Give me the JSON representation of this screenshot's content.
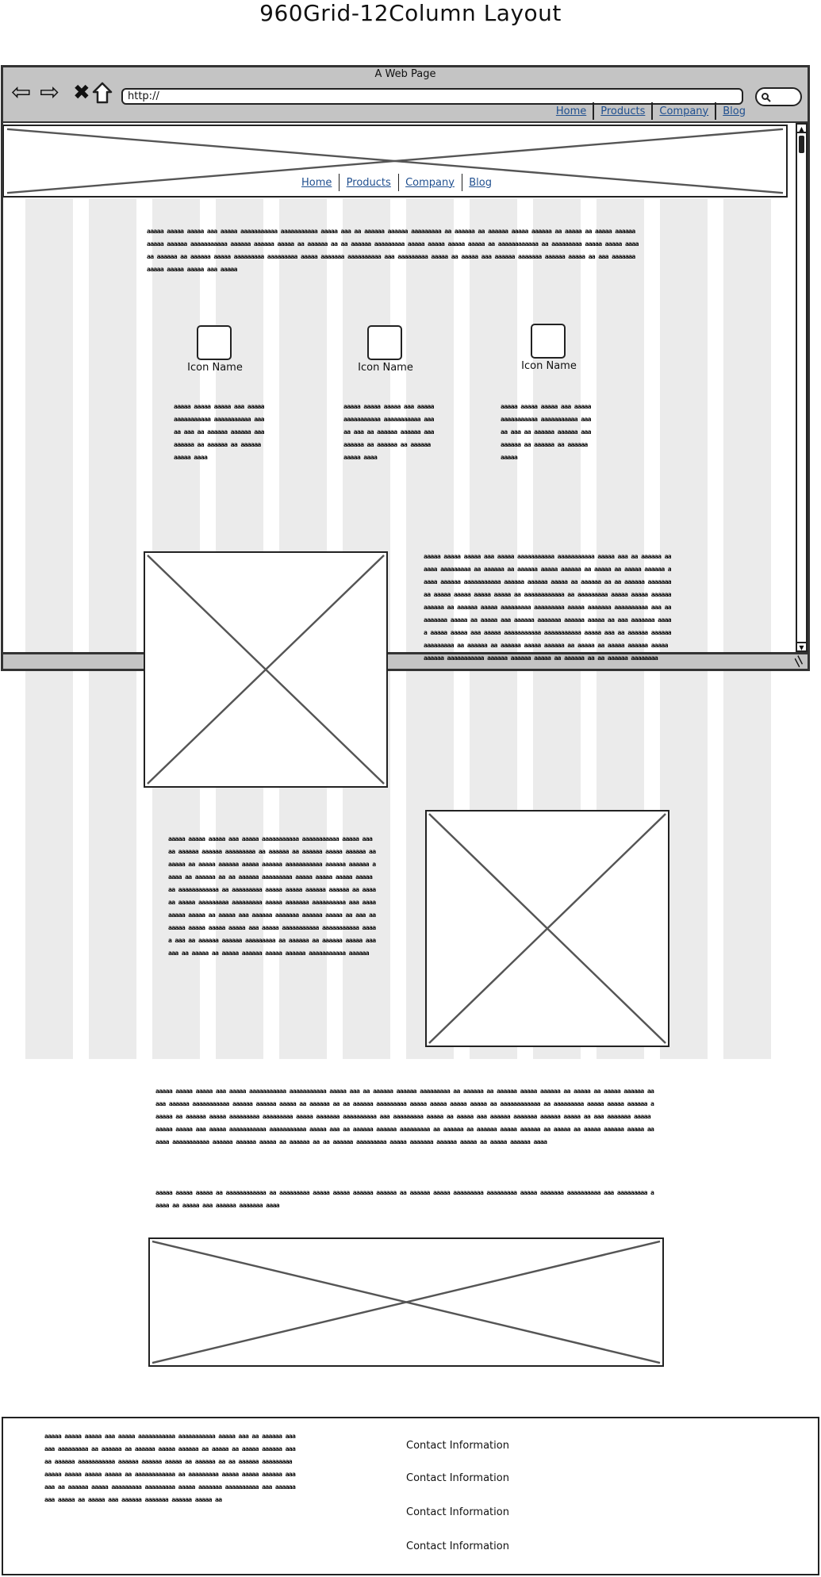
{
  "page_title": "960Grid-12Column Layout",
  "browser": {
    "window_title": "A Web Page",
    "url": "http://"
  },
  "top_nav": [
    "Home",
    "Products",
    "Company",
    "Blog"
  ],
  "inner_nav": [
    "Home",
    "Products",
    "Company",
    "Blog"
  ],
  "feature_icons": [
    {
      "label": "Icon Name",
      "icon": "square-icon"
    },
    {
      "label": "Icon Name",
      "icon": "square-icon"
    },
    {
      "label": "Icon Name",
      "icon": "square-icon"
    }
  ],
  "contacts": [
    "Contact Information",
    "Contact Information",
    "Contact Information",
    "Contact Information"
  ],
  "colors": {
    "chrome": "#c4c4c4",
    "grid_column": "#ebebeb",
    "link": "#1f4f8f"
  }
}
